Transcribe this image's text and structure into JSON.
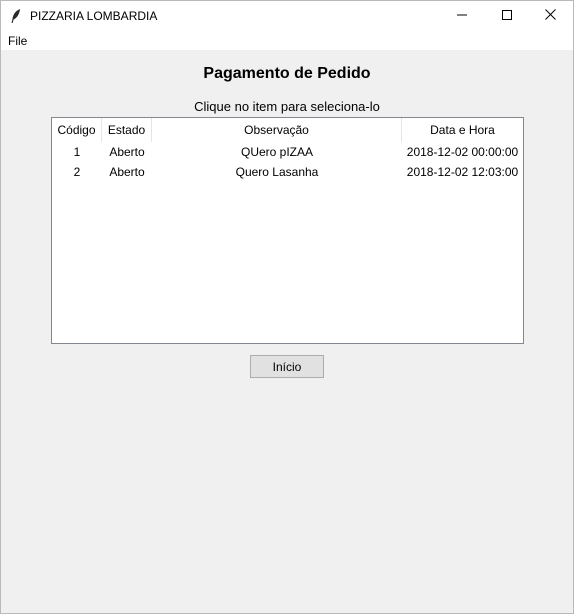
{
  "window": {
    "title": "PIZZARIA LOMBARDIA",
    "icon": "feather-icon"
  },
  "menubar": {
    "items": [
      {
        "label": "File"
      }
    ]
  },
  "page": {
    "heading": "Pagamento de Pedido",
    "instruction": "Clique no item para seleciona-lo"
  },
  "table": {
    "columns": [
      "Código",
      "Estado",
      "Observação",
      "Data e Hora"
    ],
    "rows": [
      [
        "1",
        "Aberto",
        "QUero pIZAA",
        "2018-12-02 00:00:00"
      ],
      [
        "2",
        "Aberto",
        "Quero Lasanha",
        "2018-12-02 12:03:00"
      ]
    ]
  },
  "buttons": {
    "inicio": "Início"
  }
}
